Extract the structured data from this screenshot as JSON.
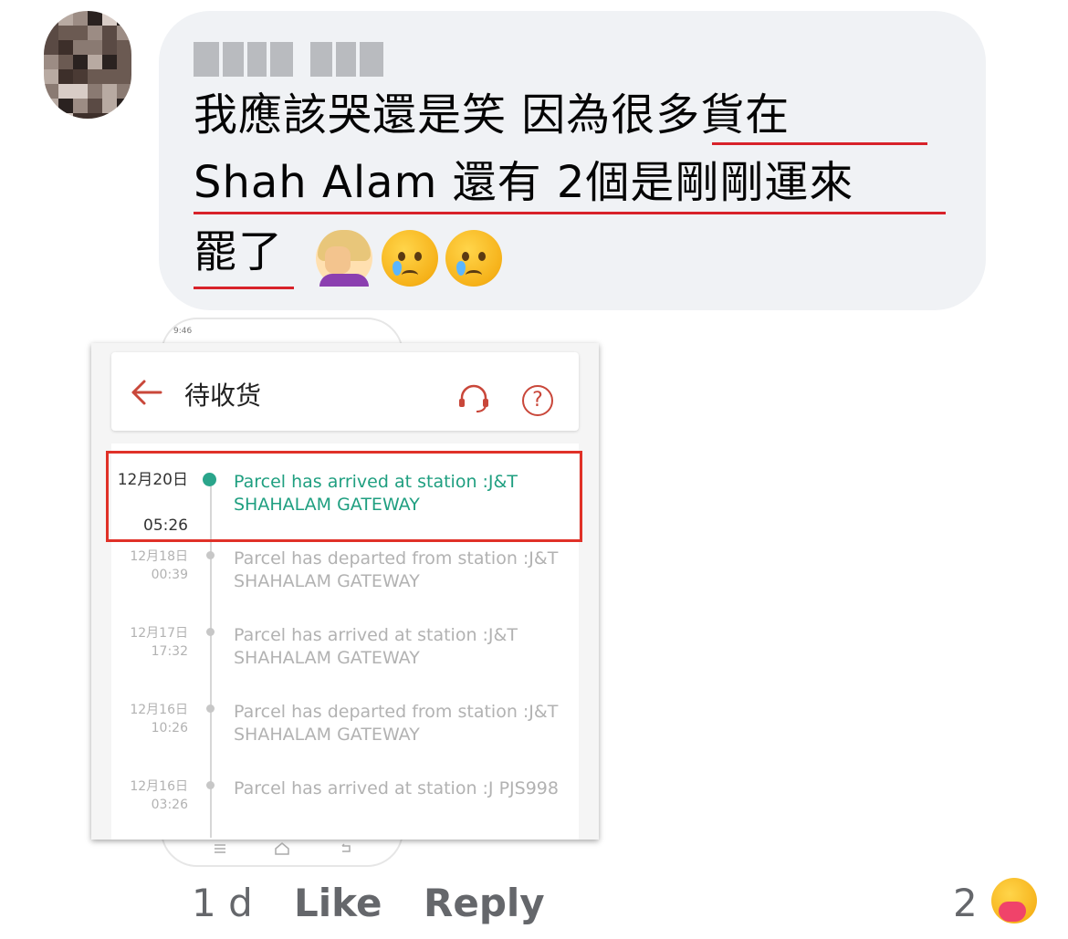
{
  "comment": {
    "author_name": "",
    "text_lines": [
      "我應該哭還是笑 因為很多貨在",
      "Shah Alam 還有 2個是剛剛運來",
      "罷了"
    ]
  },
  "screenshot": {
    "status_time": "9:46",
    "title": "待收货",
    "back_icon": "arrow-left-icon",
    "support_icon": "headset-icon",
    "help_icon": "question-circle-icon",
    "help_glyph": "?",
    "accent_color": "#c9473a",
    "active_color": "#1f9f80",
    "highlight_color": "#e03128",
    "events": [
      {
        "date": "12月20日",
        "time": "05:26",
        "message": "Parcel has arrived at station :J&T SHAHALAM GATEWAY",
        "active": true
      },
      {
        "date": "12月18日",
        "time": "00:39",
        "message": "Parcel has departed from station :J&T SHAHALAM GATEWAY",
        "active": false
      },
      {
        "date": "12月17日",
        "time": "17:32",
        "message": "Parcel has arrived at station :J&T SHAHALAM GATEWAY",
        "active": false
      },
      {
        "date": "12月16日",
        "time": "10:26",
        "message": "Parcel has departed from station :J&T SHAHALAM GATEWAY",
        "active": false
      },
      {
        "date": "12月16日",
        "time": "03:26",
        "message": "Parcel has arrived at station :J PJS998",
        "active": false
      }
    ]
  },
  "footer": {
    "age": "1 d",
    "like_label": "Like",
    "reply_label": "Reply",
    "reaction_count": "2",
    "reaction_icon": "care-emoji-icon"
  },
  "emojis": [
    "facepalm-emoji-icon",
    "crying-face-icon",
    "crying-face-icon"
  ]
}
